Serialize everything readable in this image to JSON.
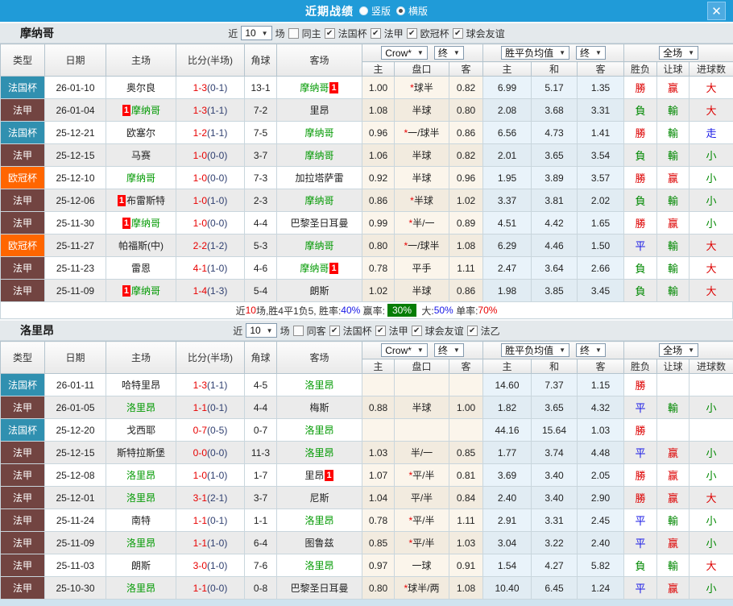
{
  "topbar": {
    "title": "近期战绩",
    "layout_options": [
      {
        "label": "竖版",
        "selected": false
      },
      {
        "label": "横版",
        "selected": true
      }
    ],
    "close_label": "✕"
  },
  "colors": {
    "法国杯": "#3090b0",
    "法甲": "#724441",
    "欧冠杯": "#ff6600",
    "topbar_blue": "#209bd8",
    "team_green": "#009900",
    "score_red": "#e80000",
    "half_navy": "#2f3f70",
    "result_red": "#dd0000",
    "result_green": "#008800",
    "result_blue": "#1717e6",
    "badge_red": "#fe0000",
    "rate_badge_green": "#057d05"
  },
  "table_header": {
    "cols": [
      "类型",
      "日期",
      "主场",
      "比分(半场)",
      "角球",
      "客场"
    ],
    "sub": [
      "主",
      "盘口",
      "客",
      "主",
      "和",
      "客",
      "胜负",
      "让球",
      "进球数"
    ],
    "groups": [
      [
        "Crow*",
        "终"
      ],
      [
        "胜平负均值",
        "终"
      ],
      [
        "全场"
      ]
    ]
  },
  "sections": [
    {
      "team": "摩纳哥",
      "filter": {
        "near": "近",
        "count": "10",
        "unit": "场",
        "same": {
          "label": "同主",
          "checked": false
        },
        "leagues": [
          {
            "label": "法国杯",
            "checked": true
          },
          {
            "label": "法甲",
            "checked": true
          },
          {
            "label": "欧冠杯",
            "checked": true
          },
          {
            "label": "球会友谊",
            "checked": true
          }
        ]
      },
      "rows": [
        {
          "type": "法国杯",
          "date": "26-01-10",
          "home": {
            "name": "奥尔良"
          },
          "score": "1-3",
          "half": "(0-1)",
          "corner": "13-1",
          "away": {
            "name": "摩纳哥",
            "green": true,
            "badge": "1",
            "badge_pos": "after"
          },
          "odds": [
            "1.00",
            "*球半",
            "0.82"
          ],
          "avg": [
            "6.99",
            "5.17",
            "1.35"
          ],
          "results": [
            [
              "勝",
              "r"
            ],
            [
              "赢",
              "r"
            ],
            [
              "大",
              "r"
            ]
          ]
        },
        {
          "type": "法甲",
          "date": "26-01-04",
          "home": {
            "name": "摩纳哥",
            "green": true,
            "badge": "1",
            "badge_pos": "before"
          },
          "score": "1-3",
          "half": "(1-1)",
          "corner": "7-2",
          "away": {
            "name": "里昂"
          },
          "odds": [
            "1.08",
            "半球",
            "0.80"
          ],
          "avg": [
            "2.08",
            "3.68",
            "3.31"
          ],
          "results": [
            [
              "負",
              "g"
            ],
            [
              "輸",
              "g"
            ],
            [
              "大",
              "r"
            ]
          ]
        },
        {
          "type": "法国杯",
          "date": "25-12-21",
          "home": {
            "name": "欧塞尔"
          },
          "score": "1-2",
          "half": "(1-1)",
          "corner": "7-5",
          "away": {
            "name": "摩纳哥",
            "green": true
          },
          "odds": [
            "0.96",
            "*一/球半",
            "0.86"
          ],
          "avg": [
            "6.56",
            "4.73",
            "1.41"
          ],
          "results": [
            [
              "勝",
              "r"
            ],
            [
              "輸",
              "g"
            ],
            [
              "走",
              "b"
            ]
          ]
        },
        {
          "type": "法甲",
          "date": "25-12-15",
          "home": {
            "name": "马赛"
          },
          "score": "1-0",
          "half": "(0-0)",
          "corner": "3-7",
          "away": {
            "name": "摩纳哥",
            "green": true
          },
          "odds": [
            "1.06",
            "半球",
            "0.82"
          ],
          "avg": [
            "2.01",
            "3.65",
            "3.54"
          ],
          "results": [
            [
              "負",
              "g"
            ],
            [
              "輸",
              "g"
            ],
            [
              "小",
              "g"
            ]
          ]
        },
        {
          "type": "欧冠杯",
          "date": "25-12-10",
          "home": {
            "name": "摩纳哥",
            "green": true
          },
          "score": "1-0",
          "half": "(0-0)",
          "corner": "7-3",
          "away": {
            "name": "加拉塔萨雷"
          },
          "odds": [
            "0.92",
            "半球",
            "0.96"
          ],
          "avg": [
            "1.95",
            "3.89",
            "3.57"
          ],
          "results": [
            [
              "勝",
              "r"
            ],
            [
              "赢",
              "r"
            ],
            [
              "小",
              "g"
            ]
          ]
        },
        {
          "type": "法甲",
          "date": "25-12-06",
          "home": {
            "name": "布雷斯特",
            "badge": "1",
            "badge_pos": "before"
          },
          "score": "1-0",
          "half": "(1-0)",
          "corner": "2-3",
          "away": {
            "name": "摩纳哥",
            "green": true
          },
          "odds": [
            "0.86",
            "*半球",
            "1.02"
          ],
          "avg": [
            "3.37",
            "3.81",
            "2.02"
          ],
          "results": [
            [
              "負",
              "g"
            ],
            [
              "輸",
              "g"
            ],
            [
              "小",
              "g"
            ]
          ]
        },
        {
          "type": "法甲",
          "date": "25-11-30",
          "home": {
            "name": "摩纳哥",
            "green": true,
            "badge": "1",
            "badge_pos": "before"
          },
          "score": "1-0",
          "half": "(0-0)",
          "corner": "4-4",
          "away": {
            "name": "巴黎圣日耳曼"
          },
          "odds": [
            "0.99",
            "*半/一",
            "0.89"
          ],
          "avg": [
            "4.51",
            "4.42",
            "1.65"
          ],
          "results": [
            [
              "勝",
              "r"
            ],
            [
              "赢",
              "r"
            ],
            [
              "小",
              "g"
            ]
          ]
        },
        {
          "type": "欧冠杯",
          "date": "25-11-27",
          "home": {
            "name": "帕福斯(中)"
          },
          "score": "2-2",
          "half": "(1-2)",
          "corner": "5-3",
          "away": {
            "name": "摩纳哥",
            "green": true
          },
          "odds": [
            "0.80",
            "*一/球半",
            "1.08"
          ],
          "avg": [
            "6.29",
            "4.46",
            "1.50"
          ],
          "results": [
            [
              "平",
              "b"
            ],
            [
              "輸",
              "g"
            ],
            [
              "大",
              "r"
            ]
          ]
        },
        {
          "type": "法甲",
          "date": "25-11-23",
          "home": {
            "name": "雷恩"
          },
          "score": "4-1",
          "half": "(1-0)",
          "corner": "4-6",
          "away": {
            "name": "摩纳哥",
            "green": true,
            "badge": "1",
            "badge_pos": "after"
          },
          "odds": [
            "0.78",
            "平手",
            "1.11"
          ],
          "avg": [
            "2.47",
            "3.64",
            "2.66"
          ],
          "results": [
            [
              "負",
              "g"
            ],
            [
              "輸",
              "g"
            ],
            [
              "大",
              "r"
            ]
          ]
        },
        {
          "type": "法甲",
          "date": "25-11-09",
          "home": {
            "name": "摩纳哥",
            "green": true,
            "badge": "1",
            "badge_pos": "before"
          },
          "score": "1-4",
          "half": "(1-3)",
          "corner": "5-4",
          "away": {
            "name": "朗斯"
          },
          "odds": [
            "1.02",
            "半球",
            "0.86"
          ],
          "avg": [
            "1.98",
            "3.85",
            "3.45"
          ],
          "results": [
            [
              "負",
              "g"
            ],
            [
              "輸",
              "g"
            ],
            [
              "大",
              "r"
            ]
          ]
        }
      ],
      "summary_parts": [
        [
          "近",
          "k"
        ],
        [
          "10",
          "r"
        ],
        [
          "场,胜4平1负5, 胜率:",
          "k"
        ],
        [
          "40%",
          "b"
        ],
        [
          " 赢率:",
          "k"
        ],
        [
          "30%",
          "badge"
        ],
        [
          " 大:",
          "k"
        ],
        [
          "50%",
          "b"
        ],
        [
          " 单率:",
          "k"
        ],
        [
          "70%",
          "r"
        ]
      ]
    },
    {
      "team": "洛里昂",
      "filter": {
        "near": "近",
        "count": "10",
        "unit": "场",
        "same": {
          "label": "同客",
          "checked": false
        },
        "leagues": [
          {
            "label": "法国杯",
            "checked": true
          },
          {
            "label": "法甲",
            "checked": true
          },
          {
            "label": "球会友谊",
            "checked": true
          },
          {
            "label": "法乙",
            "checked": true
          }
        ]
      },
      "rows": [
        {
          "type": "法国杯",
          "date": "26-01-11",
          "home": {
            "name": "哈特里昂"
          },
          "score": "1-3",
          "half": "(1-1)",
          "corner": "4-5",
          "away": {
            "name": "洛里昂",
            "green": true
          },
          "odds": [
            "",
            "",
            ""
          ],
          "avg": [
            "14.60",
            "7.37",
            "1.15"
          ],
          "results": [
            [
              "勝",
              "r"
            ],
            [
              "",
              ""
            ],
            [
              "",
              ""
            ]
          ]
        },
        {
          "type": "法甲",
          "date": "26-01-05",
          "home": {
            "name": "洛里昂",
            "green": true
          },
          "score": "1-1",
          "half": "(0-1)",
          "corner": "4-4",
          "away": {
            "name": "梅斯"
          },
          "odds": [
            "0.88",
            "半球",
            "1.00"
          ],
          "avg": [
            "1.82",
            "3.65",
            "4.32"
          ],
          "results": [
            [
              "平",
              "b"
            ],
            [
              "輸",
              "g"
            ],
            [
              "小",
              "g"
            ]
          ]
        },
        {
          "type": "法国杯",
          "date": "25-12-20",
          "home": {
            "name": "戈西耶"
          },
          "score": "0-7",
          "half": "(0-5)",
          "corner": "0-7",
          "away": {
            "name": "洛里昂",
            "green": true
          },
          "odds": [
            "",
            "",
            ""
          ],
          "avg": [
            "44.16",
            "15.64",
            "1.03"
          ],
          "results": [
            [
              "勝",
              "r"
            ],
            [
              "",
              ""
            ],
            [
              "",
              ""
            ]
          ]
        },
        {
          "type": "法甲",
          "date": "25-12-15",
          "home": {
            "name": "斯特拉斯堡"
          },
          "score": "0-0",
          "half": "(0-0)",
          "corner": "11-3",
          "away": {
            "name": "洛里昂",
            "green": true
          },
          "odds": [
            "1.03",
            "半/一",
            "0.85"
          ],
          "avg": [
            "1.77",
            "3.74",
            "4.48"
          ],
          "results": [
            [
              "平",
              "b"
            ],
            [
              "赢",
              "r"
            ],
            [
              "小",
              "g"
            ]
          ]
        },
        {
          "type": "法甲",
          "date": "25-12-08",
          "home": {
            "name": "洛里昂",
            "green": true
          },
          "score": "1-0",
          "half": "(1-0)",
          "corner": "1-7",
          "away": {
            "name": "里昂",
            "badge": "1",
            "badge_pos": "after"
          },
          "odds": [
            "1.07",
            "*平/半",
            "0.81"
          ],
          "avg": [
            "3.69",
            "3.40",
            "2.05"
          ],
          "results": [
            [
              "勝",
              "r"
            ],
            [
              "赢",
              "r"
            ],
            [
              "小",
              "g"
            ]
          ]
        },
        {
          "type": "法甲",
          "date": "25-12-01",
          "home": {
            "name": "洛里昂",
            "green": true
          },
          "score": "3-1",
          "half": "(2-1)",
          "corner": "3-7",
          "away": {
            "name": "尼斯"
          },
          "odds": [
            "1.04",
            "平/半",
            "0.84"
          ],
          "avg": [
            "2.40",
            "3.40",
            "2.90"
          ],
          "results": [
            [
              "勝",
              "r"
            ],
            [
              "赢",
              "r"
            ],
            [
              "大",
              "r"
            ]
          ]
        },
        {
          "type": "法甲",
          "date": "25-11-24",
          "home": {
            "name": "南特"
          },
          "score": "1-1",
          "half": "(0-1)",
          "corner": "1-1",
          "away": {
            "name": "洛里昂",
            "green": true
          },
          "odds": [
            "0.78",
            "*平/半",
            "1.11"
          ],
          "avg": [
            "2.91",
            "3.31",
            "2.45"
          ],
          "results": [
            [
              "平",
              "b"
            ],
            [
              "輸",
              "g"
            ],
            [
              "小",
              "g"
            ]
          ]
        },
        {
          "type": "法甲",
          "date": "25-11-09",
          "home": {
            "name": "洛里昂",
            "green": true
          },
          "score": "1-1",
          "half": "(1-0)",
          "corner": "6-4",
          "away": {
            "name": "图鲁兹"
          },
          "odds": [
            "0.85",
            "*平/半",
            "1.03"
          ],
          "avg": [
            "3.04",
            "3.22",
            "2.40"
          ],
          "results": [
            [
              "平",
              "b"
            ],
            [
              "赢",
              "r"
            ],
            [
              "小",
              "g"
            ]
          ]
        },
        {
          "type": "法甲",
          "date": "25-11-03",
          "home": {
            "name": "朗斯"
          },
          "score": "3-0",
          "half": "(1-0)",
          "corner": "7-6",
          "away": {
            "name": "洛里昂",
            "green": true
          },
          "odds": [
            "0.97",
            "一球",
            "0.91"
          ],
          "avg": [
            "1.54",
            "4.27",
            "5.82"
          ],
          "results": [
            [
              "負",
              "g"
            ],
            [
              "輸",
              "g"
            ],
            [
              "大",
              "r"
            ]
          ]
        },
        {
          "type": "法甲",
          "date": "25-10-30",
          "home": {
            "name": "洛里昂",
            "green": true
          },
          "score": "1-1",
          "half": "(0-0)",
          "corner": "0-8",
          "away": {
            "name": "巴黎圣日耳曼"
          },
          "odds": [
            "0.80",
            "*球半/两",
            "1.08"
          ],
          "avg": [
            "10.40",
            "6.45",
            "1.24"
          ],
          "results": [
            [
              "平",
              "b"
            ],
            [
              "赢",
              "r"
            ],
            [
              "小",
              "g"
            ]
          ]
        }
      ]
    }
  ]
}
